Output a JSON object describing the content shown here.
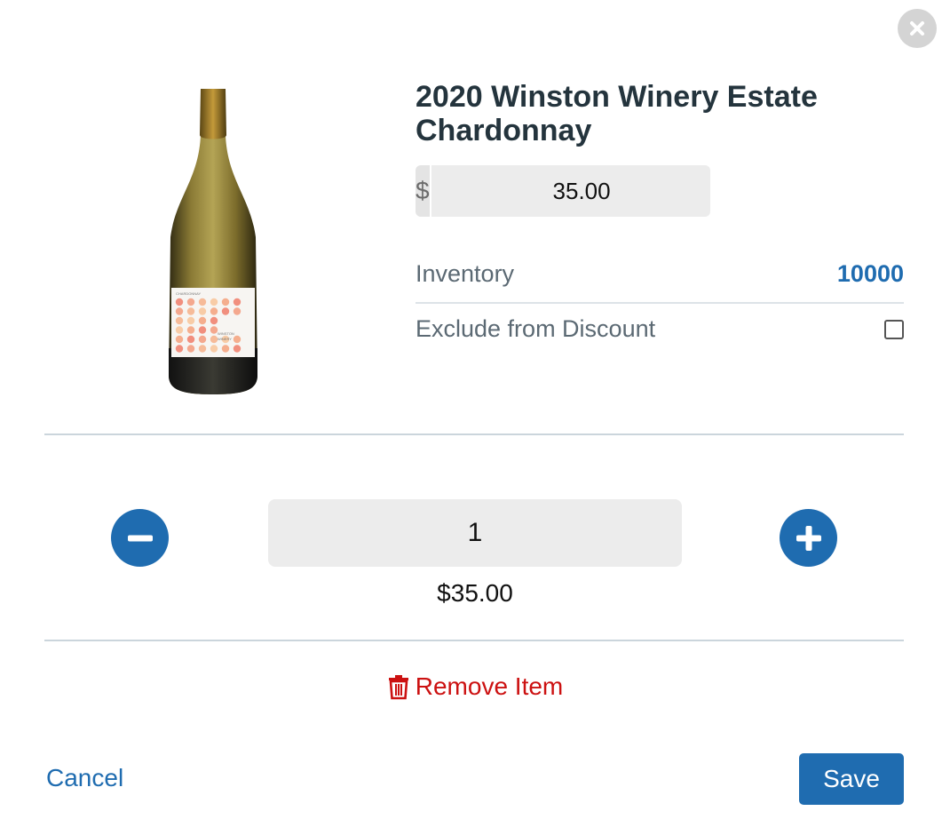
{
  "product": {
    "title": "2020 Winston Winery Estate Chardonnay",
    "image_label_lines": [
      "CHARDONNAY",
      "SONOMA COUNTY",
      "WINSTON",
      "WINERY"
    ]
  },
  "price": {
    "currency_symbol": "$",
    "value": "35.00"
  },
  "inventory": {
    "label": "Inventory",
    "value": "10000"
  },
  "discount": {
    "label": "Exclude from Discount",
    "checked": false
  },
  "quantity": {
    "value": "1",
    "line_total": "$35.00"
  },
  "actions": {
    "remove_label": "Remove Item",
    "cancel_label": "Cancel",
    "save_label": "Save"
  },
  "icons": {
    "close": "close-icon",
    "minus": "minus-icon",
    "plus": "plus-icon",
    "trash": "trash-icon"
  },
  "colors": {
    "accent": "#1f6cb0",
    "danger": "#cc1111",
    "title": "#24343d",
    "muted_label": "#5b6973"
  }
}
